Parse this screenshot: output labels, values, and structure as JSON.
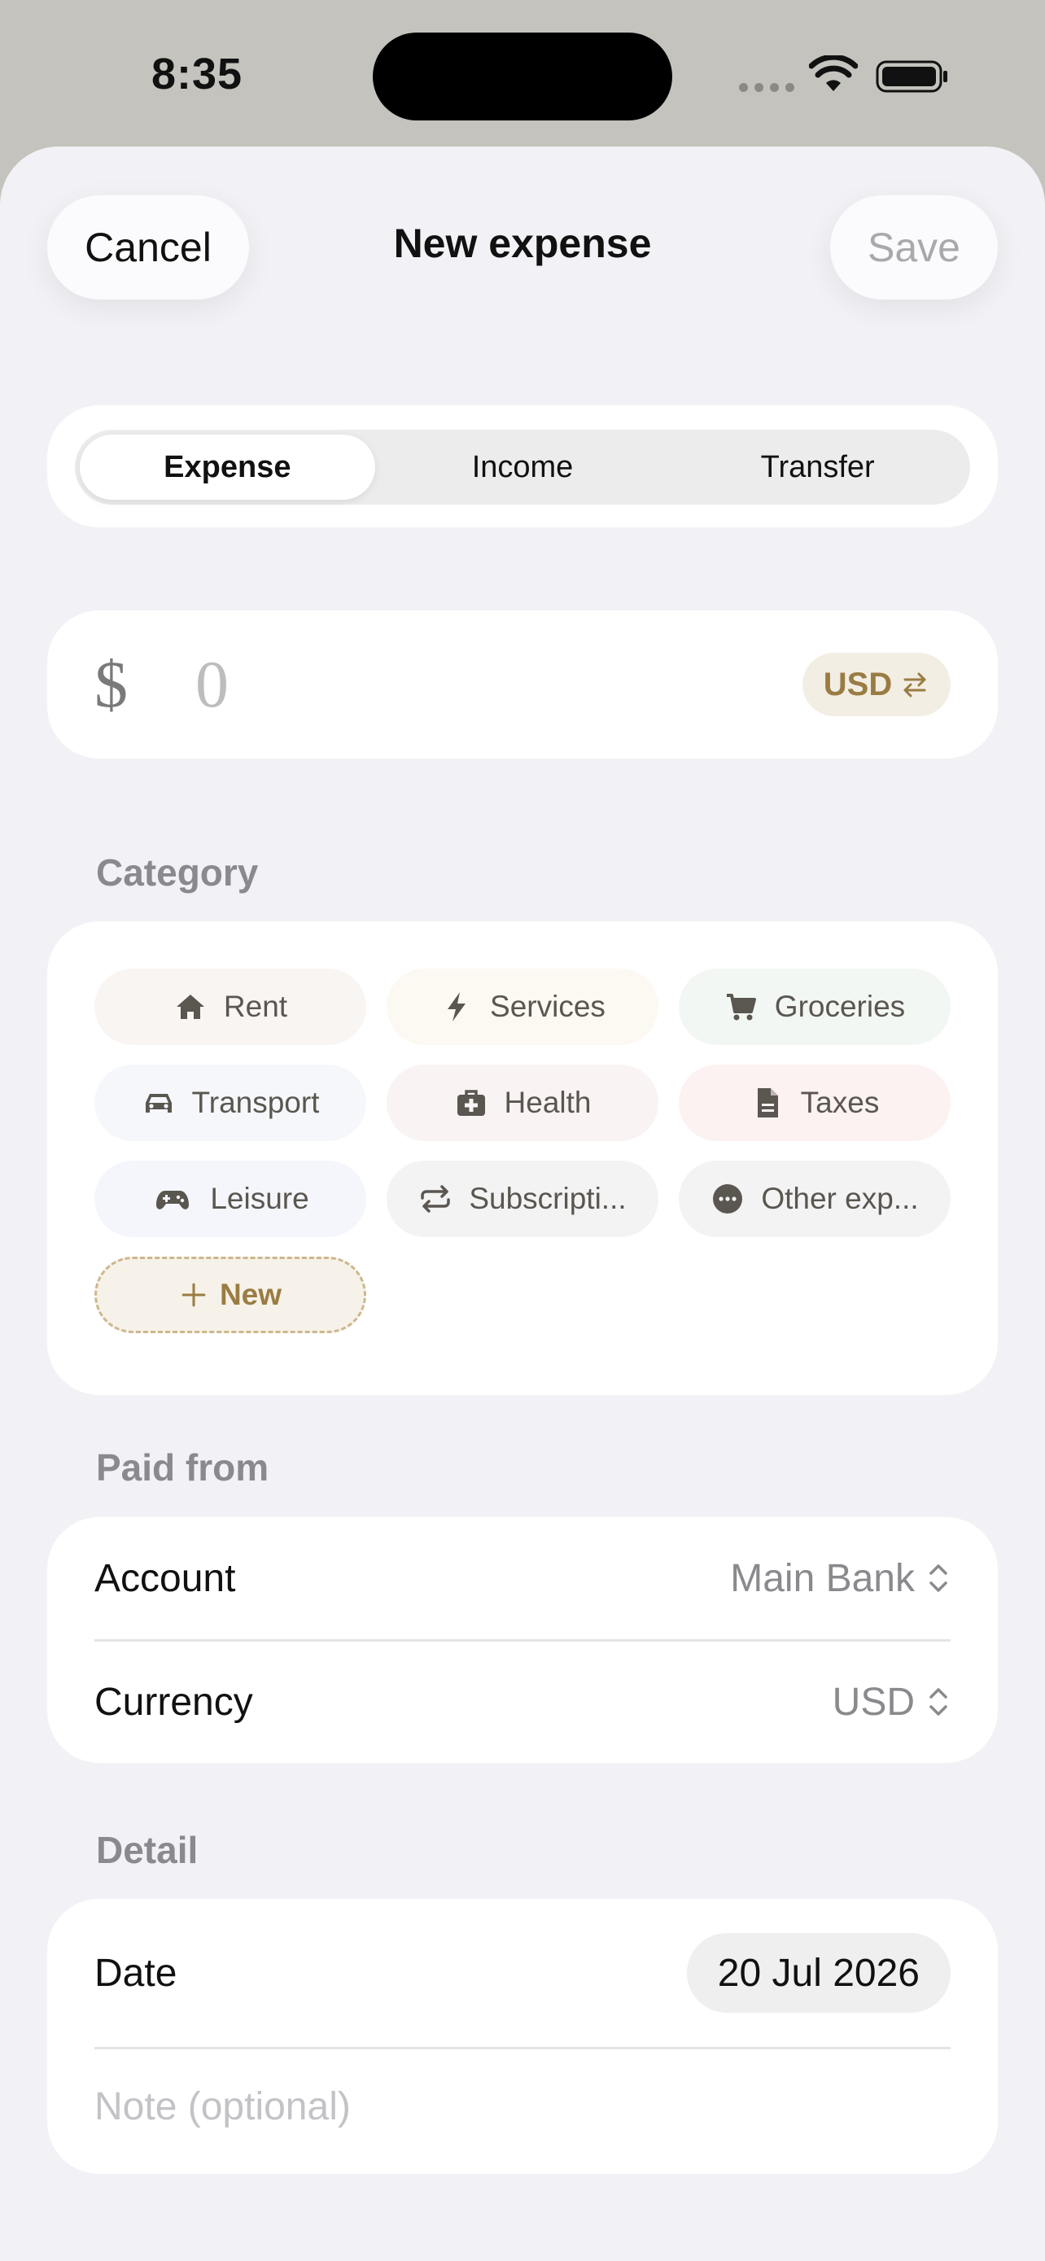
{
  "status_bar": {
    "time": "8:35"
  },
  "nav": {
    "cancel_label": "Cancel",
    "title": "New expense",
    "save_label": "Save"
  },
  "type_tabs": [
    {
      "label": "Expense",
      "selected": true
    },
    {
      "label": "Income",
      "selected": false
    },
    {
      "label": "Transfer",
      "selected": false
    }
  ],
  "amount": {
    "symbol": "$",
    "value": "0",
    "currency": "USD"
  },
  "category": {
    "section_label": "Category",
    "items": [
      {
        "label": "Rent",
        "icon": "house-icon",
        "bg": "#f9f5f2"
      },
      {
        "label": "Services",
        "icon": "bolt-icon",
        "bg": "#fbf9f1"
      },
      {
        "label": "Groceries",
        "icon": "cart-icon",
        "bg": "#f3f7f4"
      },
      {
        "label": "Transport",
        "icon": "car-icon",
        "bg": "#f5f7fb"
      },
      {
        "label": "Health",
        "icon": "medkit-icon",
        "bg": "#f9f3f3"
      },
      {
        "label": "Taxes",
        "icon": "document-icon",
        "bg": "#fbf2f1"
      },
      {
        "label": "Leisure",
        "icon": "gamepad-icon",
        "bg": "#f5f6fb"
      },
      {
        "label": "Subscripti...",
        "icon": "repeat-icon",
        "bg": "#f3f3f3"
      },
      {
        "label": "Other exp...",
        "icon": "more-icon",
        "bg": "#f3f3f3"
      }
    ],
    "new_label": "New"
  },
  "paid_from": {
    "section_label": "Paid from",
    "account_label": "Account",
    "account_value": "Main Bank",
    "currency_label": "Currency",
    "currency_value": "USD"
  },
  "detail": {
    "section_label": "Detail",
    "date_label": "Date",
    "date_value": "20 Jul 2026",
    "note_placeholder": "Note (optional)"
  },
  "colors": {
    "accent": "#9a7c43",
    "sheet_bg": "#f2f2f6",
    "backdrop": "#c4c3bd"
  }
}
